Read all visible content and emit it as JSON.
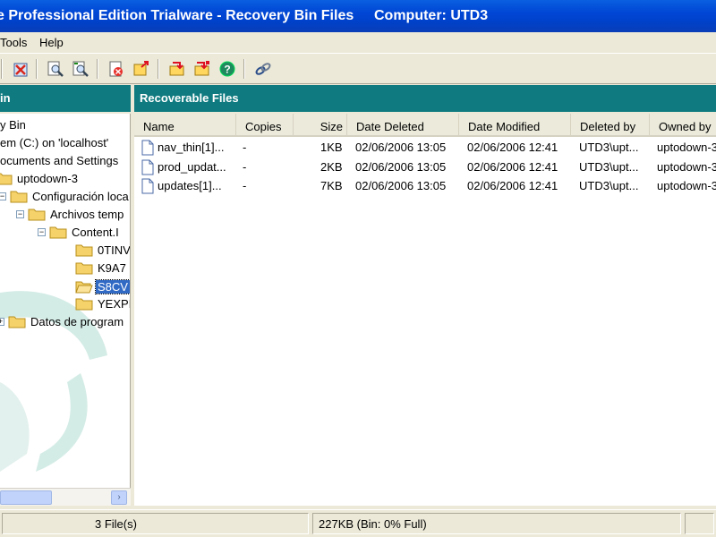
{
  "window": {
    "title_left": "e Professional Edition Trialware - Recovery Bin Files",
    "title_right": "Computer: UTD3"
  },
  "menu": [
    "Tools",
    "Help"
  ],
  "toolbar": [
    "empty-bin-icon",
    "find-icon",
    "find-next-icon",
    "delete-icon",
    "restore-icon",
    "recover-icon",
    "recover-all-icon",
    "help-icon",
    "link-icon"
  ],
  "left_panel": {
    "header": "in"
  },
  "tree": [
    {
      "label": "y Bin"
    },
    {
      "label": "em (C:) on 'localhost'"
    },
    {
      "label": "ocuments and Settings"
    },
    {
      "label": "uptodown-3"
    },
    {
      "label": "Configuración loca"
    },
    {
      "label": "Archivos temp"
    },
    {
      "label": "Content.I"
    },
    {
      "label": "0TINV"
    },
    {
      "label": "K9A7"
    },
    {
      "label": "S8CV"
    },
    {
      "label": "YEXPI"
    },
    {
      "label": "Datos de program"
    }
  ],
  "right_panel": {
    "header": "Recoverable Files"
  },
  "columns": [
    "Name",
    "Copies",
    "Size",
    "Date Deleted",
    "Date Modified",
    "Deleted by",
    "Owned by"
  ],
  "files": [
    {
      "name": "nav_thin[1]...",
      "copies": "-",
      "size": "1KB",
      "deleted": "02/06/2006 13:05",
      "modified": "02/06/2006 12:41",
      "deleted_by": "UTD3\\upt...",
      "owned_by": "uptodown-3"
    },
    {
      "name": "prod_updat...",
      "copies": "-",
      "size": "2KB",
      "deleted": "02/06/2006 13:05",
      "modified": "02/06/2006 12:41",
      "deleted_by": "UTD3\\upt...",
      "owned_by": "uptodown-3"
    },
    {
      "name": "updates[1]...",
      "copies": "-",
      "size": "7KB",
      "deleted": "02/06/2006 13:05",
      "modified": "02/06/2006 12:41",
      "deleted_by": "UTD3\\upt...",
      "owned_by": "uptodown-3"
    }
  ],
  "status": {
    "file_count": "3 File(s)",
    "bin_info": "227KB (Bin: 0% Full)"
  },
  "colors": {
    "title_blue": "#0046d5",
    "panel_header_teal": "#0f7b80",
    "selection_blue": "#316ac5"
  }
}
